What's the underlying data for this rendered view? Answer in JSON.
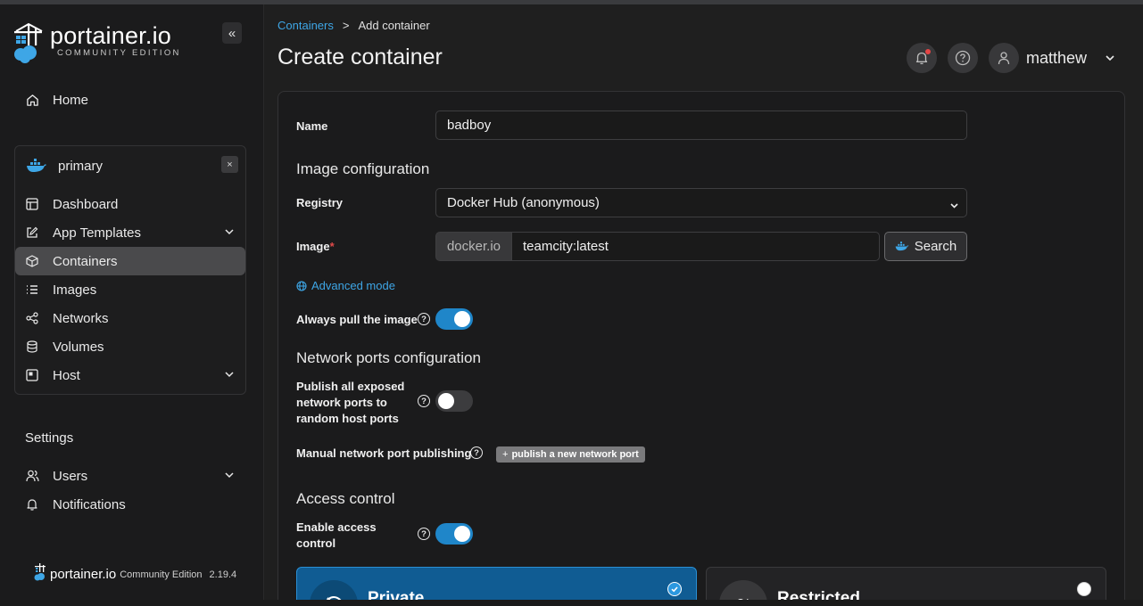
{
  "sidebar": {
    "logo_title": "portainer.io",
    "logo_subtitle": "COMMUNITY EDITION",
    "collapse_icon": "«",
    "home": "Home",
    "environment": {
      "name": "primary",
      "close": "×",
      "items": {
        "dashboard": "Dashboard",
        "app_templates": "App Templates",
        "containers": "Containers",
        "images": "Images",
        "networks": "Networks",
        "volumes": "Volumes",
        "host": "Host"
      }
    },
    "settings_heading": "Settings",
    "users": "Users",
    "notifications": "Notifications",
    "footer": {
      "brand": "portainer.io",
      "edition": "Community Edition",
      "version": "2.19.4"
    }
  },
  "header": {
    "breadcrumb_link": "Containers",
    "breadcrumb_sep": ">",
    "breadcrumb_current": "Add container",
    "title": "Create container",
    "username": "matthew"
  },
  "form": {
    "name_label": "Name",
    "name_value": "badboy",
    "image_config_title": "Image configuration",
    "registry_label": "Registry",
    "registry_value": "Docker Hub (anonymous)",
    "image_label": "Image",
    "image_required": "*",
    "image_prefix": "docker.io",
    "image_value": "teamcity:latest",
    "search_label": "Search",
    "advanced_mode": "Advanced mode",
    "always_pull_label": "Always pull the image",
    "always_pull_on": true,
    "network_title": "Network ports configuration",
    "publish_all_line1": "Publish all exposed",
    "publish_all_line2": "network ports to",
    "publish_all_line3": "random host ports",
    "publish_all_on": false,
    "manual_publish_label": "Manual network port publishing",
    "publish_new_btn": "publish a new network port",
    "publish_plus": "+",
    "access_title": "Access control",
    "enable_access_line1": "Enable access",
    "enable_access_line2": "control",
    "enable_access_on": true,
    "card_private": "Private",
    "card_restricted": "Restricted",
    "help_glyph": "?"
  },
  "colors": {
    "accent": "#1f86c9",
    "link": "#3ea6e6",
    "private_card": "#105c93"
  }
}
